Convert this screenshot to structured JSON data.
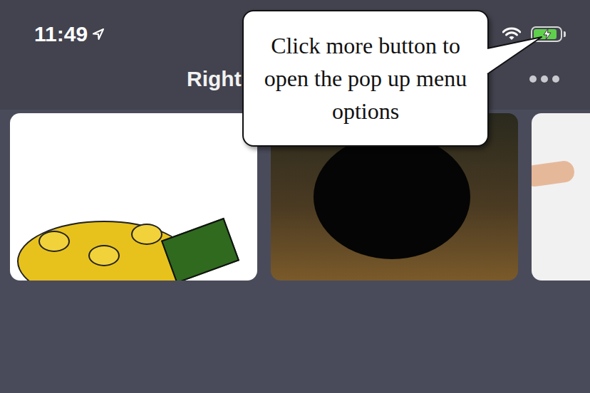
{
  "status_bar": {
    "time": "11:49",
    "battery_charging": true,
    "battery_level": 0.9
  },
  "nav": {
    "title": "Right"
  },
  "tooltip": {
    "text": "Click more button to open the pop up menu options"
  },
  "cards": [
    {
      "kind": "clipart"
    },
    {
      "kind": "forest"
    },
    {
      "kind": "hand"
    }
  ]
}
